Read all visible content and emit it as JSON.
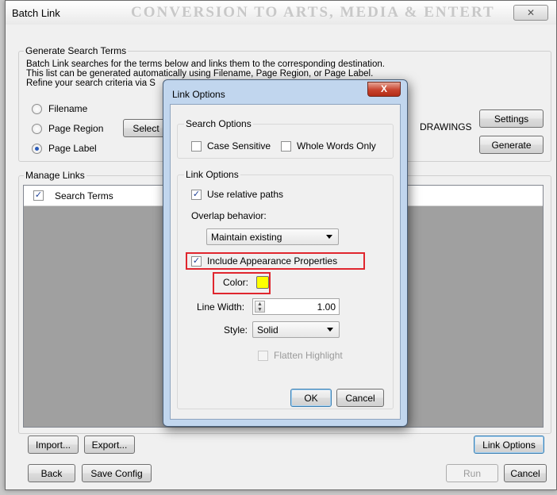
{
  "window": {
    "title": "Batch Link",
    "background_document_text": "CONVERSION TO ARTS, MEDIA & ENTERT",
    "close_label": "✕"
  },
  "generate_section": {
    "label": "Generate Search Terms",
    "description_line1": "Batch Link searches for the terms below and links them to the corresponding destination.",
    "description_line2": "This list can be generated automatically using Filename, Page Region, or Page Label.",
    "description_line3": "Refine your search criteria via S",
    "radios": [
      {
        "label": "Filename",
        "checked": false
      },
      {
        "label": "Page Region",
        "checked": false
      },
      {
        "label": "Page Label",
        "checked": true
      }
    ],
    "select_label": "Select",
    "drawings_text": "DRAWINGS",
    "settings_label": "Settings",
    "generate_label": "Generate"
  },
  "manage_section": {
    "label": "Manage Links",
    "column_header": "Search Terms",
    "header_checked": true
  },
  "buttons": {
    "import": "Import...",
    "export": "Export...",
    "link_options": "Link Options",
    "back": "Back",
    "save_config": "Save Config",
    "run": "Run",
    "cancel": "Cancel"
  },
  "dialog": {
    "title": "Link Options",
    "close_label": "X",
    "search_options": {
      "label": "Search Options",
      "case_sensitive": {
        "label": "Case Sensitive",
        "checked": false
      },
      "whole_words": {
        "label": "Whole Words Only",
        "checked": false
      }
    },
    "link_options": {
      "label": "Link Options",
      "use_relative_paths": {
        "label": "Use relative paths",
        "checked": true
      },
      "overlap_label": "Overlap behavior:",
      "overlap_value": "Maintain existing",
      "include_appearance": {
        "label": "Include Appearance Properties",
        "checked": true
      },
      "color_label": "Color:",
      "color_value": "#ffff00",
      "line_width_label": "Line Width:",
      "line_width_value": "1.00",
      "style_label": "Style:",
      "style_value": "Solid",
      "flatten_highlight": {
        "label": "Flatten Highlight",
        "checked": false
      }
    },
    "ok_label": "OK",
    "cancel_label": "Cancel"
  },
  "annotation_color": "#e0262e"
}
